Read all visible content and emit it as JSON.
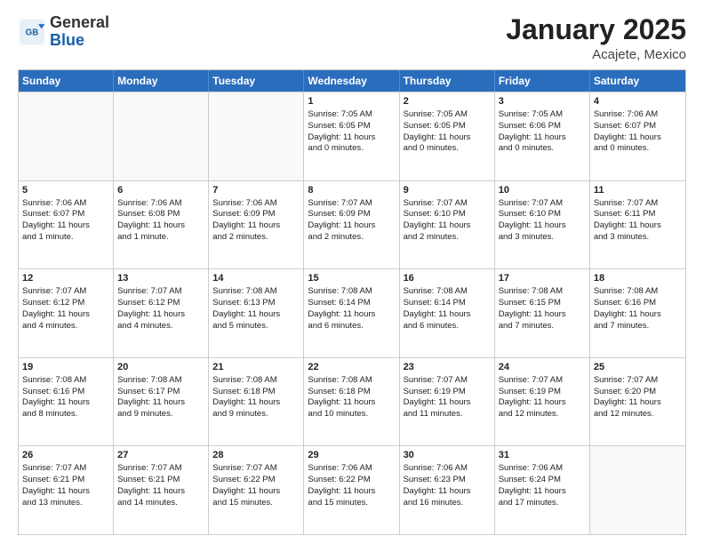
{
  "logo": {
    "general": "General",
    "blue": "Blue"
  },
  "header": {
    "month": "January 2025",
    "location": "Acajete, Mexico"
  },
  "days": [
    "Sunday",
    "Monday",
    "Tuesday",
    "Wednesday",
    "Thursday",
    "Friday",
    "Saturday"
  ],
  "weeks": [
    [
      {
        "num": "",
        "info": "",
        "empty": true
      },
      {
        "num": "",
        "info": "",
        "empty": true
      },
      {
        "num": "",
        "info": "",
        "empty": true
      },
      {
        "num": "1",
        "info": "Sunrise: 7:05 AM\nSunset: 6:05 PM\nDaylight: 11 hours\nand 0 minutes.",
        "empty": false
      },
      {
        "num": "2",
        "info": "Sunrise: 7:05 AM\nSunset: 6:05 PM\nDaylight: 11 hours\nand 0 minutes.",
        "empty": false
      },
      {
        "num": "3",
        "info": "Sunrise: 7:05 AM\nSunset: 6:06 PM\nDaylight: 11 hours\nand 0 minutes.",
        "empty": false
      },
      {
        "num": "4",
        "info": "Sunrise: 7:06 AM\nSunset: 6:07 PM\nDaylight: 11 hours\nand 0 minutes.",
        "empty": false
      }
    ],
    [
      {
        "num": "5",
        "info": "Sunrise: 7:06 AM\nSunset: 6:07 PM\nDaylight: 11 hours\nand 1 minute.",
        "empty": false
      },
      {
        "num": "6",
        "info": "Sunrise: 7:06 AM\nSunset: 6:08 PM\nDaylight: 11 hours\nand 1 minute.",
        "empty": false
      },
      {
        "num": "7",
        "info": "Sunrise: 7:06 AM\nSunset: 6:09 PM\nDaylight: 11 hours\nand 2 minutes.",
        "empty": false
      },
      {
        "num": "8",
        "info": "Sunrise: 7:07 AM\nSunset: 6:09 PM\nDaylight: 11 hours\nand 2 minutes.",
        "empty": false
      },
      {
        "num": "9",
        "info": "Sunrise: 7:07 AM\nSunset: 6:10 PM\nDaylight: 11 hours\nand 2 minutes.",
        "empty": false
      },
      {
        "num": "10",
        "info": "Sunrise: 7:07 AM\nSunset: 6:10 PM\nDaylight: 11 hours\nand 3 minutes.",
        "empty": false
      },
      {
        "num": "11",
        "info": "Sunrise: 7:07 AM\nSunset: 6:11 PM\nDaylight: 11 hours\nand 3 minutes.",
        "empty": false
      }
    ],
    [
      {
        "num": "12",
        "info": "Sunrise: 7:07 AM\nSunset: 6:12 PM\nDaylight: 11 hours\nand 4 minutes.",
        "empty": false
      },
      {
        "num": "13",
        "info": "Sunrise: 7:07 AM\nSunset: 6:12 PM\nDaylight: 11 hours\nand 4 minutes.",
        "empty": false
      },
      {
        "num": "14",
        "info": "Sunrise: 7:08 AM\nSunset: 6:13 PM\nDaylight: 11 hours\nand 5 minutes.",
        "empty": false
      },
      {
        "num": "15",
        "info": "Sunrise: 7:08 AM\nSunset: 6:14 PM\nDaylight: 11 hours\nand 6 minutes.",
        "empty": false
      },
      {
        "num": "16",
        "info": "Sunrise: 7:08 AM\nSunset: 6:14 PM\nDaylight: 11 hours\nand 6 minutes.",
        "empty": false
      },
      {
        "num": "17",
        "info": "Sunrise: 7:08 AM\nSunset: 6:15 PM\nDaylight: 11 hours\nand 7 minutes.",
        "empty": false
      },
      {
        "num": "18",
        "info": "Sunrise: 7:08 AM\nSunset: 6:16 PM\nDaylight: 11 hours\nand 7 minutes.",
        "empty": false
      }
    ],
    [
      {
        "num": "19",
        "info": "Sunrise: 7:08 AM\nSunset: 6:16 PM\nDaylight: 11 hours\nand 8 minutes.",
        "empty": false
      },
      {
        "num": "20",
        "info": "Sunrise: 7:08 AM\nSunset: 6:17 PM\nDaylight: 11 hours\nand 9 minutes.",
        "empty": false
      },
      {
        "num": "21",
        "info": "Sunrise: 7:08 AM\nSunset: 6:18 PM\nDaylight: 11 hours\nand 9 minutes.",
        "empty": false
      },
      {
        "num": "22",
        "info": "Sunrise: 7:08 AM\nSunset: 6:18 PM\nDaylight: 11 hours\nand 10 minutes.",
        "empty": false
      },
      {
        "num": "23",
        "info": "Sunrise: 7:07 AM\nSunset: 6:19 PM\nDaylight: 11 hours\nand 11 minutes.",
        "empty": false
      },
      {
        "num": "24",
        "info": "Sunrise: 7:07 AM\nSunset: 6:19 PM\nDaylight: 11 hours\nand 12 minutes.",
        "empty": false
      },
      {
        "num": "25",
        "info": "Sunrise: 7:07 AM\nSunset: 6:20 PM\nDaylight: 11 hours\nand 12 minutes.",
        "empty": false
      }
    ],
    [
      {
        "num": "26",
        "info": "Sunrise: 7:07 AM\nSunset: 6:21 PM\nDaylight: 11 hours\nand 13 minutes.",
        "empty": false
      },
      {
        "num": "27",
        "info": "Sunrise: 7:07 AM\nSunset: 6:21 PM\nDaylight: 11 hours\nand 14 minutes.",
        "empty": false
      },
      {
        "num": "28",
        "info": "Sunrise: 7:07 AM\nSunset: 6:22 PM\nDaylight: 11 hours\nand 15 minutes.",
        "empty": false
      },
      {
        "num": "29",
        "info": "Sunrise: 7:06 AM\nSunset: 6:22 PM\nDaylight: 11 hours\nand 15 minutes.",
        "empty": false
      },
      {
        "num": "30",
        "info": "Sunrise: 7:06 AM\nSunset: 6:23 PM\nDaylight: 11 hours\nand 16 minutes.",
        "empty": false
      },
      {
        "num": "31",
        "info": "Sunrise: 7:06 AM\nSunset: 6:24 PM\nDaylight: 11 hours\nand 17 minutes.",
        "empty": false
      },
      {
        "num": "",
        "info": "",
        "empty": true
      }
    ]
  ]
}
